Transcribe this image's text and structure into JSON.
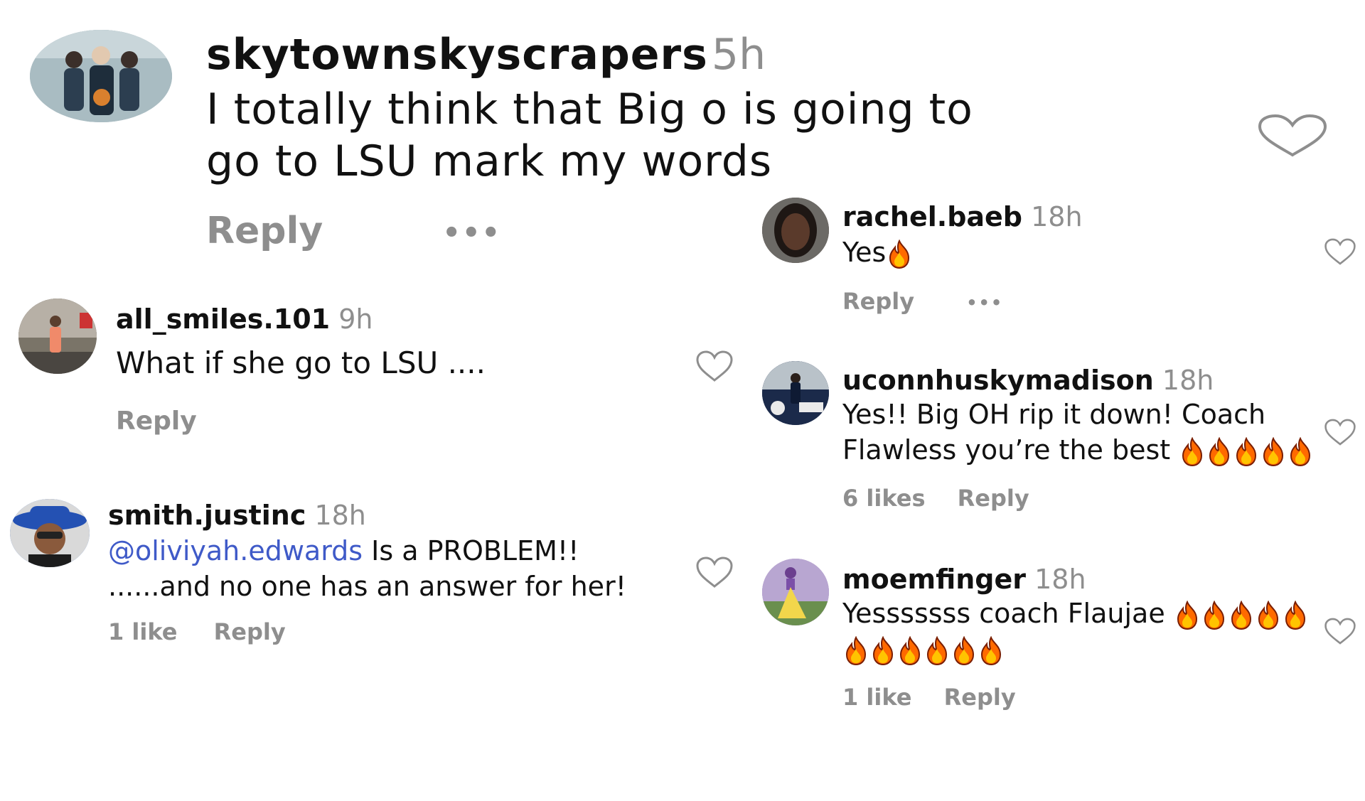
{
  "accent_colors": {
    "mention": "#3f5ac8",
    "muted": "#8e8e8e",
    "heart": "#8e8e8e",
    "fire": "#ff6a00"
  },
  "icons": {
    "like": "heart-outline-icon",
    "more": "more-dots-icon",
    "emoji": "fire-emoji"
  },
  "comments": [
    {
      "id": "main",
      "username": "skytownskyscrapers",
      "time": "5h",
      "lines": [
        "I totally think that Big o is going to",
        "go to LSU mark my words"
      ],
      "reply_label": "Reply",
      "more_label": "•••"
    },
    {
      "id": "all_smiles",
      "username": "all_smiles.101",
      "time": "9h",
      "lines": [
        "What if she go to LSU ...."
      ],
      "reply_label": "Reply"
    },
    {
      "id": "smith",
      "username": "smith.justinc",
      "time": "18h",
      "mention": "@oliviyah.edwards",
      "lines": [
        " Is a PROBLEM!!",
        "......and no one has an answer for her!"
      ],
      "likes": "1 like",
      "reply_label": "Reply"
    },
    {
      "id": "rachel",
      "username": "rachel.baeb",
      "time": "18h",
      "lines": [
        "Yes"
      ],
      "fire_count": 1,
      "reply_label": "Reply",
      "more_label": "•••"
    },
    {
      "id": "uconn",
      "username": "uconnhuskymadison",
      "time": "18h",
      "lines": [
        "Yes!! Big OH rip it down! Coach",
        "Flawless you’re the best "
      ],
      "fire_count": 5,
      "likes": "6 likes",
      "reply_label": "Reply"
    },
    {
      "id": "moem",
      "username": "moemfinger",
      "time": "18h",
      "lines": [
        "Yesssssss coach Flaujae "
      ],
      "fire_count_line1": 5,
      "fire_count_line2": 6,
      "likes": "1 like",
      "reply_label": "Reply"
    }
  ]
}
